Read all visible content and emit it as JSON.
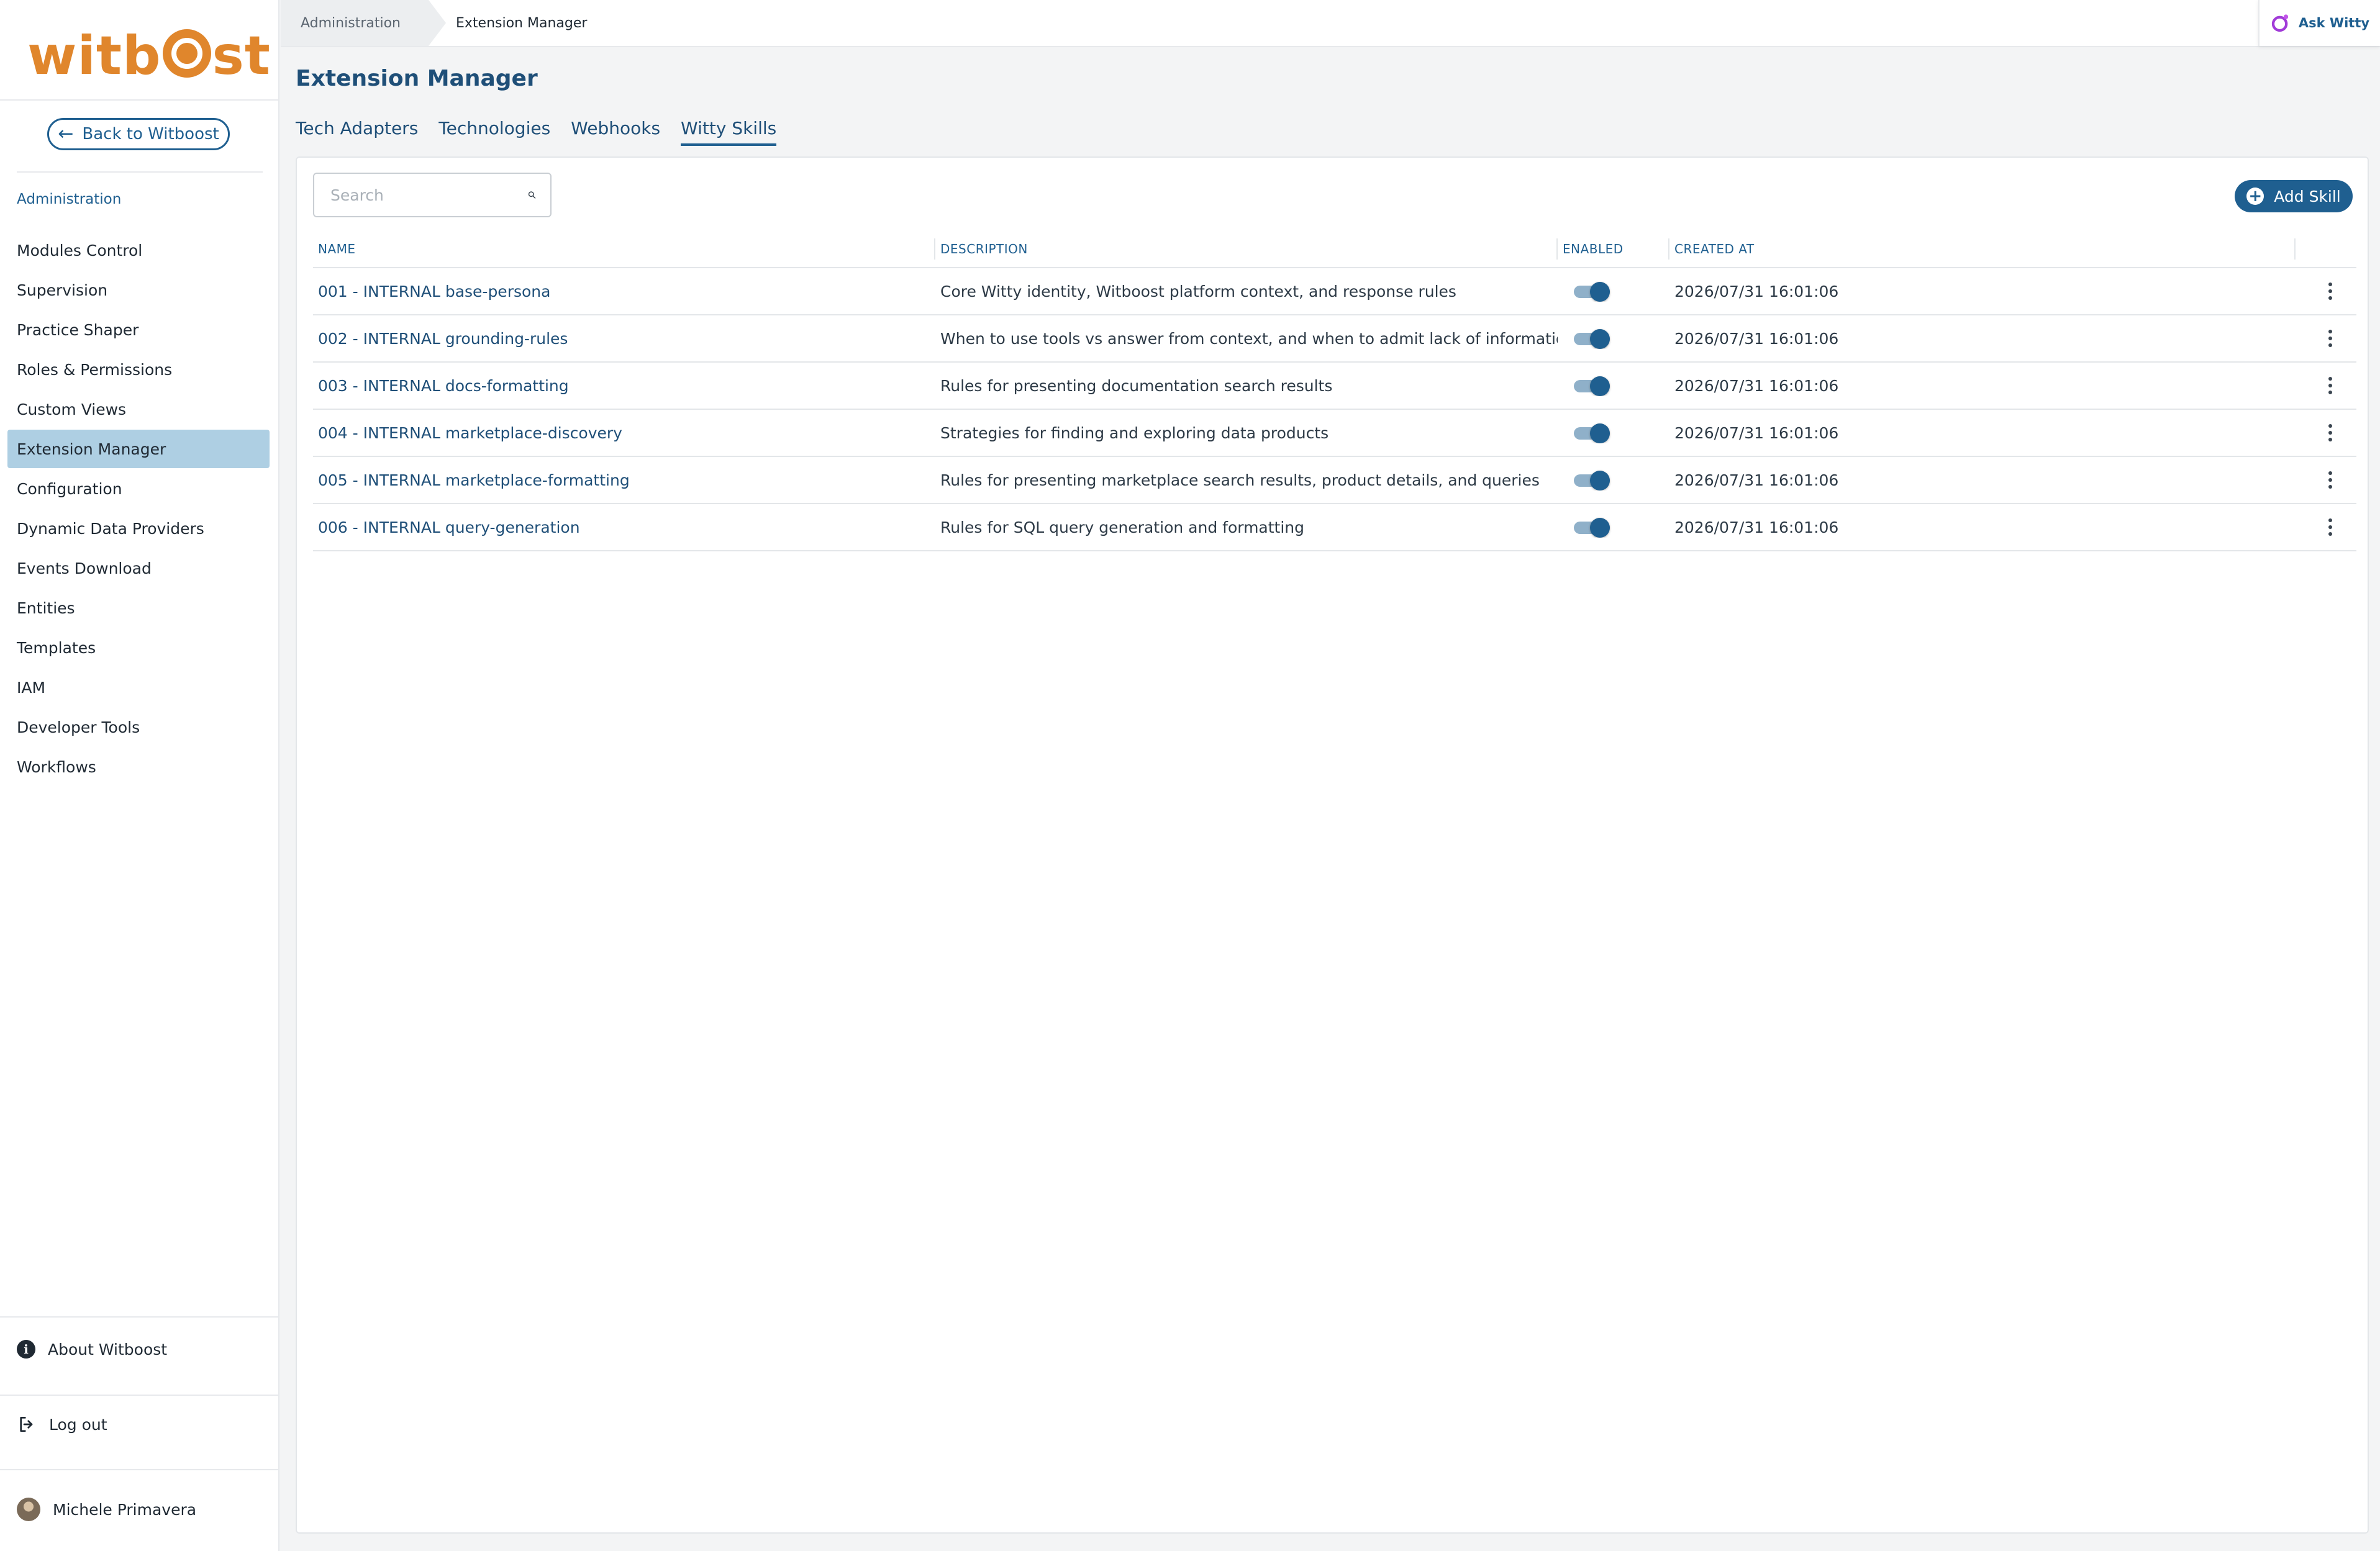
{
  "brand": {
    "logo_text_left": "witb",
    "logo_text_right": "st",
    "accent_color": "#e0862c",
    "primary_color": "#1f5f90"
  },
  "sidebar": {
    "back_label": "Back to Witboost",
    "section_label": "Administration",
    "items": [
      {
        "label": "Modules Control",
        "active": false
      },
      {
        "label": "Supervision",
        "active": false
      },
      {
        "label": "Practice Shaper",
        "active": false
      },
      {
        "label": "Roles & Permissions",
        "active": false
      },
      {
        "label": "Custom Views",
        "active": false
      },
      {
        "label": "Extension Manager",
        "active": true
      },
      {
        "label": "Configuration",
        "active": false
      },
      {
        "label": "Dynamic Data Providers",
        "active": false
      },
      {
        "label": "Events Download",
        "active": false
      },
      {
        "label": "Entities",
        "active": false
      },
      {
        "label": "Templates",
        "active": false
      },
      {
        "label": "IAM",
        "active": false
      },
      {
        "label": "Developer Tools",
        "active": false
      },
      {
        "label": "Workflows",
        "active": false
      }
    ],
    "about_label": "About Witboost",
    "logout_label": "Log out",
    "user_name": "Michele Primavera"
  },
  "topbar": {
    "breadcrumb": [
      "Administration",
      "Extension Manager"
    ],
    "ask_label": "Ask Witty"
  },
  "page": {
    "title": "Extension Manager",
    "tabs": [
      {
        "label": "Tech Adapters",
        "active": false
      },
      {
        "label": "Technologies",
        "active": false
      },
      {
        "label": "Webhooks",
        "active": false
      },
      {
        "label": "Witty Skills",
        "active": true
      }
    ]
  },
  "toolbar": {
    "search_placeholder": "Search",
    "add_label": "Add Skill"
  },
  "table": {
    "columns": [
      "NAME",
      "DESCRIPTION",
      "ENABLED",
      "CREATED AT"
    ],
    "rows": [
      {
        "name": "001 - INTERNAL base-persona",
        "description": "Core Witty identity, Witboost platform context, and response rules",
        "enabled": true,
        "created_at": "2026/07/31 16:01:06"
      },
      {
        "name": "002 - INTERNAL grounding-rules",
        "description": "When to use tools vs answer from context, and when to admit lack of information",
        "enabled": true,
        "created_at": "2026/07/31 16:01:06"
      },
      {
        "name": "003 - INTERNAL docs-formatting",
        "description": "Rules for presenting documentation search results",
        "enabled": true,
        "created_at": "2026/07/31 16:01:06"
      },
      {
        "name": "004 - INTERNAL marketplace-discovery",
        "description": "Strategies for finding and exploring data products",
        "enabled": true,
        "created_at": "2026/07/31 16:01:06"
      },
      {
        "name": "005 - INTERNAL marketplace-formatting",
        "description": "Rules for presenting marketplace search results, product details, and queries",
        "enabled": true,
        "created_at": "2026/07/31 16:01:06"
      },
      {
        "name": "006 - INTERNAL query-generation",
        "description": "Rules for SQL query generation and formatting",
        "enabled": true,
        "created_at": "2026/07/31 16:01:06"
      }
    ]
  }
}
